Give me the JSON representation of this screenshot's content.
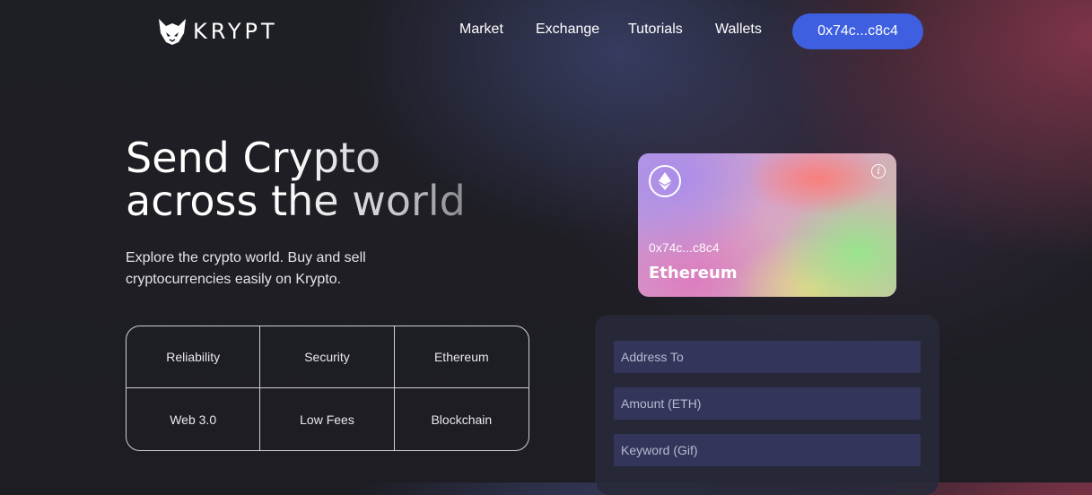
{
  "nav": {
    "logo_text": "KRYPT",
    "links": [
      "Market",
      "Exchange",
      "Tutorials",
      "Wallets"
    ],
    "wallet_button": "0x74c...c8c4"
  },
  "hero": {
    "title_line1": "Send Crypto",
    "title_line2": "across the world",
    "subtitle": "Explore the crypto world. Buy and sell cryptocurrencies easily on Krypto.",
    "features": [
      "Reliability",
      "Security",
      "Ethereum",
      "Web 3.0",
      "Low Fees",
      "Blockchain"
    ]
  },
  "card": {
    "address": "0x74c...c8c4",
    "network": "Ethereum"
  },
  "form": {
    "address_placeholder": "Address To",
    "amount_placeholder": "Amount (ETH)",
    "keyword_placeholder": "Keyword (Gif)"
  },
  "colors": {
    "accent": "#3d5fe0",
    "background": "#1e1e25",
    "input_bg": "#33365a"
  }
}
